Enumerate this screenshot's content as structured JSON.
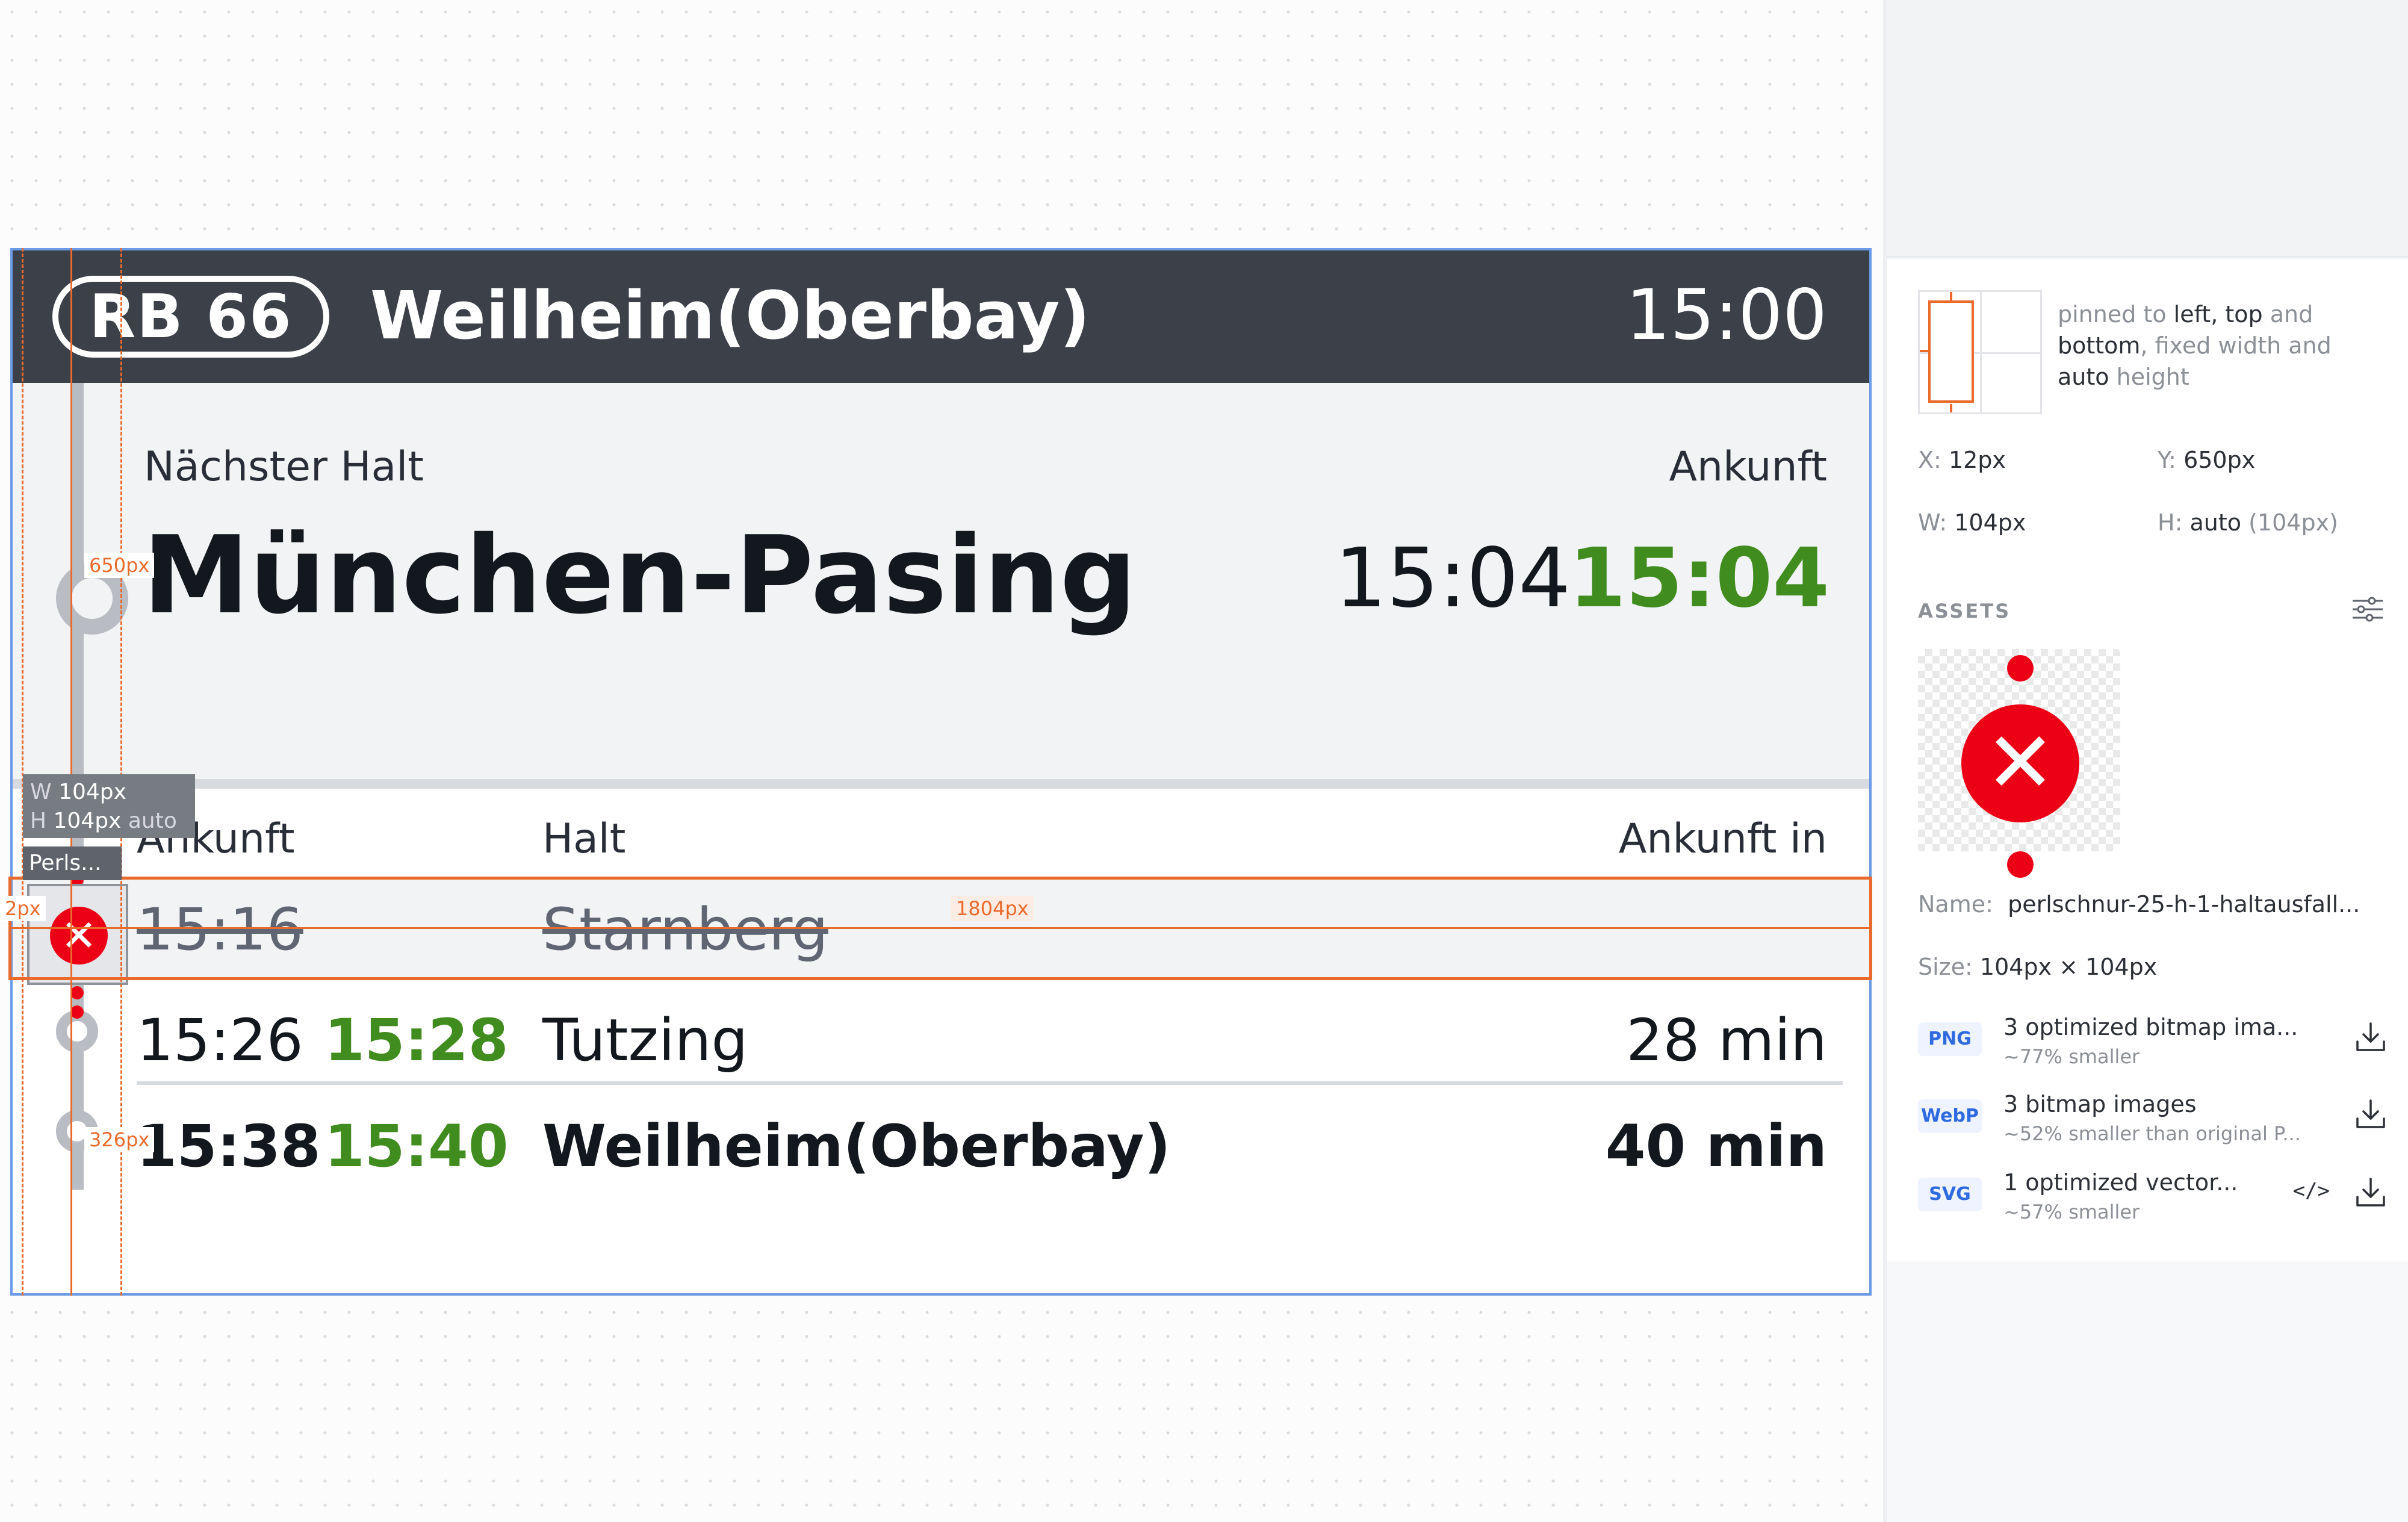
{
  "display": {
    "line": "RB 66",
    "destination": "Weilheim(Oberbay)",
    "clock": "15:00",
    "next_stop_label": "Nächster Halt",
    "arrival_label": "Ankunft",
    "next_stop": "München-Pasing",
    "next_scheduled": "15:04",
    "next_realtime": "15:04",
    "columns": {
      "arrival": "Ankunft",
      "stop": "Halt",
      "arrival_in": "Ankunft in"
    },
    "rows": [
      {
        "scheduled": "15:16",
        "realtime": "",
        "stop": "Starnberg",
        "arrival_in": "",
        "cancelled": true
      },
      {
        "scheduled": "15:26",
        "realtime": "15:28",
        "stop": "Tutzing",
        "arrival_in": "28 min",
        "cancelled": false
      },
      {
        "scheduled": "15:38",
        "realtime": "15:40",
        "stop": "Weilheim(Oberbay)",
        "arrival_in": "40 min",
        "cancelled": false
      }
    ]
  },
  "overlays": {
    "measure_650": "650px",
    "measure_326": "326px",
    "measure_2": "2px",
    "measure_1804": "1804px",
    "tooltip_w_key": "W",
    "tooltip_w_val": "104px",
    "tooltip_h_key": "H",
    "tooltip_h_val": "104px",
    "tooltip_h_mode": "auto",
    "name_chip": "Perls..."
  },
  "inspector": {
    "pin_text_1": "pinned to ",
    "pin_text_2": "left, top",
    "pin_text_3": " and ",
    "pin_text_4": "bottom",
    "pin_text_5": ", fixed ",
    "pin_text_6": "width",
    "pin_text_7": " and ",
    "pin_text_8": "auto",
    "pin_text_9": " height",
    "x_label": "X:",
    "x_value": "12px",
    "y_label": "Y:",
    "y_value": "650px",
    "w_label": "W:",
    "w_value": "104px",
    "h_label": "H:",
    "h_value": "auto",
    "h_extra": "(104px)",
    "assets_title": "ASSETS",
    "name_label": "Name:",
    "name_value": "perlschnur-25-h-1-haltausfall...",
    "size_label": "Size:",
    "size_value": "104px × 104px",
    "exports": [
      {
        "format": "PNG",
        "title": "3 optimized bitmap ima...",
        "sub": "~77% smaller"
      },
      {
        "format": "WebP",
        "title": "3 bitmap images",
        "sub": "~52% smaller than original P..."
      },
      {
        "format": "SVG",
        "title": "1 optimized vector...",
        "sub": "~57% smaller"
      }
    ]
  },
  "colors": {
    "header_bg": "#3c4049",
    "realtime_green": "#408c1e",
    "cancel_red": "#ec0016",
    "guide_orange": "#ea6a2b",
    "frame_blue": "#6b9be6"
  },
  "icons": [
    "close-icon",
    "settings-sliders-icon",
    "download-icon",
    "code-icon"
  ]
}
